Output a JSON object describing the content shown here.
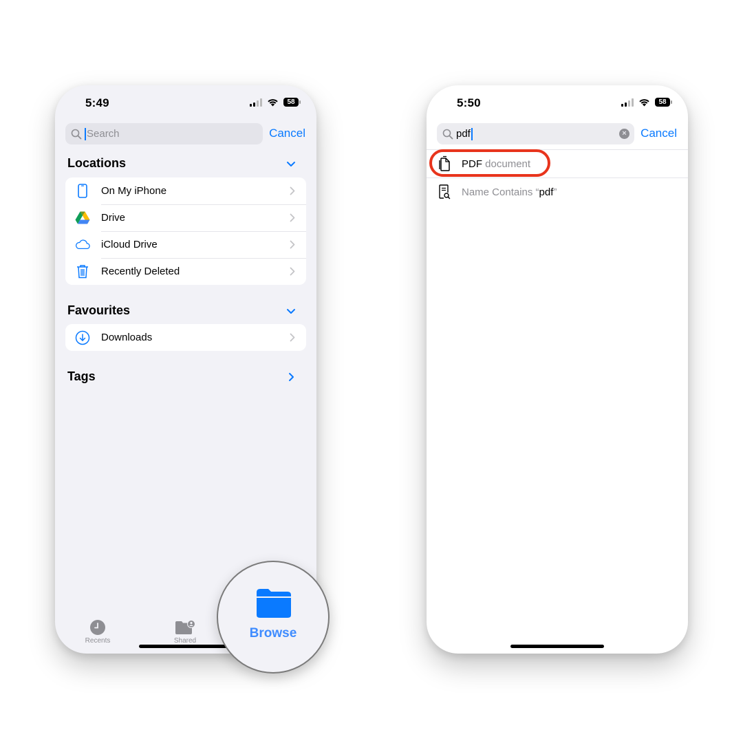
{
  "left": {
    "time": "5:49",
    "battery": "58",
    "search": {
      "placeholder": "Search",
      "cancel": "Cancel"
    },
    "locations": {
      "title": "Locations",
      "items": [
        {
          "label": "On My iPhone",
          "icon": "iphone-icon"
        },
        {
          "label": "Drive",
          "icon": "google-drive-icon"
        },
        {
          "label": "iCloud Drive",
          "icon": "icloud-icon"
        },
        {
          "label": "Recently Deleted",
          "icon": "trash-icon"
        }
      ]
    },
    "favourites": {
      "title": "Favourites",
      "items": [
        {
          "label": "Downloads",
          "icon": "download-circle-icon"
        }
      ]
    },
    "tags": {
      "title": "Tags"
    },
    "tabs": [
      {
        "label": "Recents",
        "icon": "clock-icon"
      },
      {
        "label": "Shared",
        "icon": "shared-folder-icon"
      },
      {
        "label": "Browse",
        "icon": "folder-icon"
      }
    ]
  },
  "right": {
    "time": "5:50",
    "battery": "58",
    "search": {
      "query": "pdf",
      "cancel": "Cancel"
    },
    "results": [
      {
        "prefix": "PDF",
        "suffix": "document",
        "icon": "documents-icon"
      },
      {
        "prefix": "Name Contains “",
        "query": "pdf",
        "suffix": "”",
        "icon": "doc-search-icon"
      }
    ]
  },
  "colors": {
    "accent": "#0a7aff",
    "highlight": "#e8341c",
    "background_grouped": "#f2f2f7"
  }
}
